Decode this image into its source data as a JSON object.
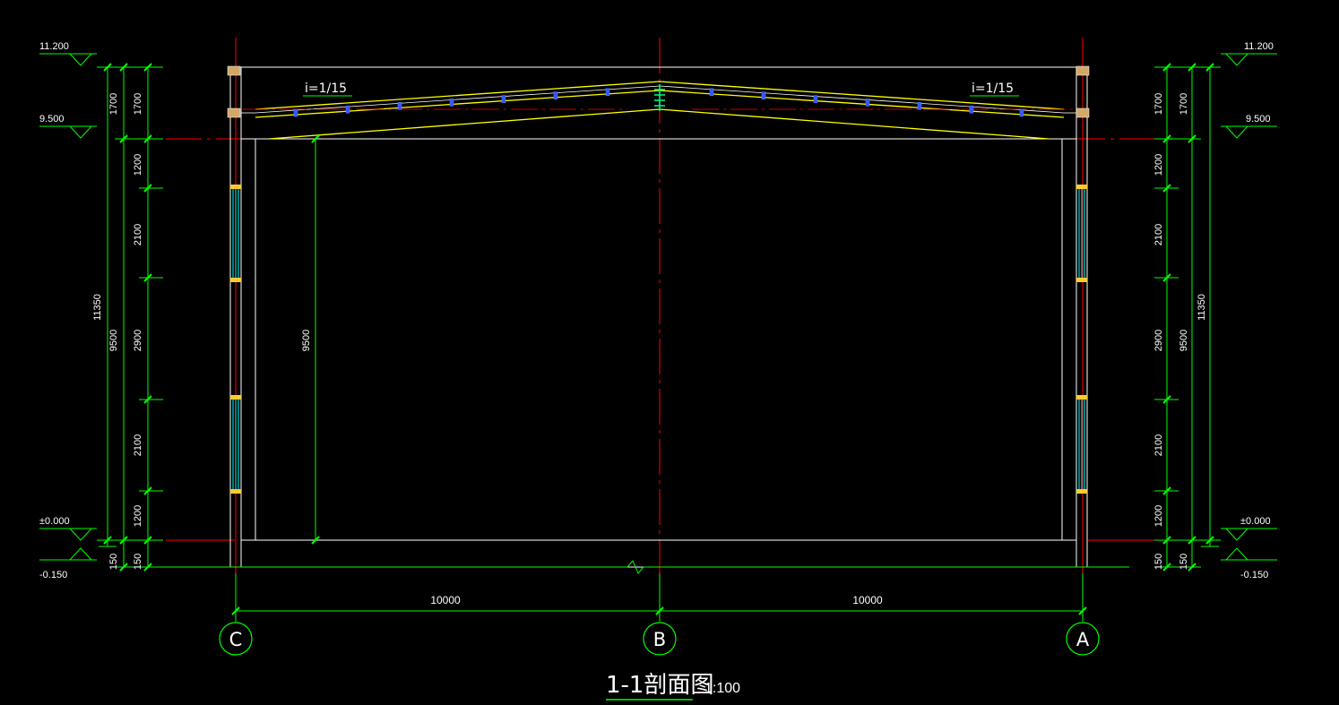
{
  "drawing": {
    "title": "1-1剖面图",
    "scale": "1:100"
  },
  "elevations": {
    "top_left": "11.200",
    "top_right": "11.200",
    "eave_left": "9.500",
    "eave_right": "9.500",
    "ground_left": "±0.000",
    "ground_right": "±0.000",
    "base_left": "-0.150",
    "base_right": "-0.150"
  },
  "slopes": {
    "left": "i=1/15",
    "right": "i=1/15"
  },
  "dims": {
    "seg_1700": "1700",
    "seg_1200": "1200",
    "seg_2100": "2100",
    "seg_2900": "2900",
    "seg_150": "150",
    "total_11350": "11350",
    "total_9500": "9500",
    "interior_9500": "9500",
    "span_left": "10000",
    "span_right": "10000"
  },
  "axes": [
    "C",
    "B",
    "A"
  ],
  "colors": {
    "dim": "#00ff00",
    "axis": "#ff0000",
    "truss": "#ffff00",
    "wall": "#ffffff",
    "window": "#00ffff",
    "purlin": "#0000ff"
  }
}
